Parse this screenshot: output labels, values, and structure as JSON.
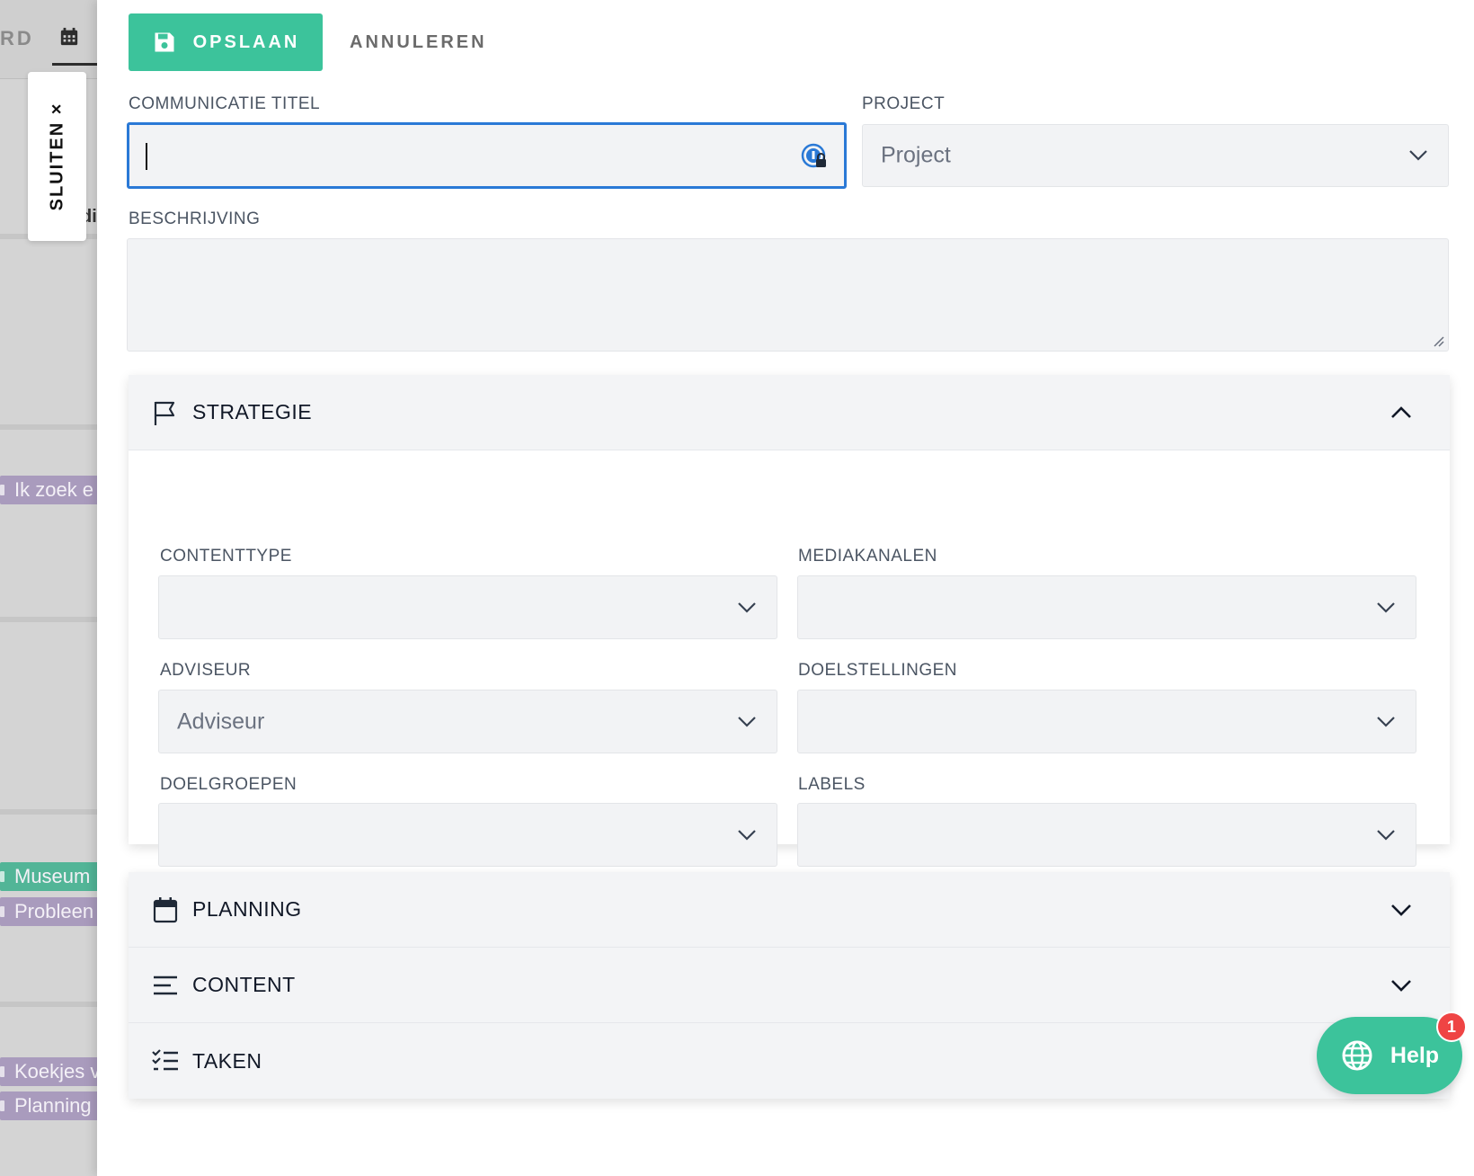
{
  "background": {
    "tab_partial_text": "RD",
    "body_fragment": "di",
    "chips": [
      {
        "label": "Ik zoek e",
        "color": "#a99bbd"
      },
      {
        "label": "Museum",
        "color": "#52b597"
      },
      {
        "label": "Probleen",
        "color": "#a99bbd"
      },
      {
        "label": "Koekjes v",
        "color": "#a99bbd"
      },
      {
        "label": "Planning",
        "color": "#a99bbd"
      }
    ]
  },
  "close_tab": {
    "label": "SLUITEN ×"
  },
  "toolbar": {
    "save_label": "OPSLAAN",
    "cancel_label": "ANNULEREN"
  },
  "form": {
    "title_label": "COMMUNICATIE TITEL",
    "title_value": "",
    "project_label": "PROJECT",
    "project_placeholder": "Project",
    "description_label": "BESCHRIJVING",
    "description_value": ""
  },
  "strategy": {
    "title": "STRATEGIE",
    "expanded": true,
    "fields": {
      "contenttype": {
        "label": "CONTENTTYPE",
        "value": ""
      },
      "mediakanalen": {
        "label": "MEDIAKANALEN",
        "value": ""
      },
      "adviseur": {
        "label": "ADVISEUR",
        "value": "Adviseur"
      },
      "doelstellingen": {
        "label": "DOELSTELLINGEN",
        "value": ""
      },
      "doelgroepen": {
        "label": "DOELGROEPEN",
        "value": ""
      },
      "labels": {
        "label": "LABELS",
        "value": ""
      }
    }
  },
  "sections": {
    "planning": {
      "title": "PLANNING",
      "expanded": false
    },
    "content": {
      "title": "CONTENT",
      "expanded": false
    },
    "taken": {
      "title": "TAKEN",
      "expanded": false
    }
  },
  "help": {
    "label": "Help",
    "badge": "1"
  },
  "colors": {
    "accent": "#3cc39b",
    "focus": "#2a79d6",
    "badge": "#ef4444",
    "chip_purple": "#a99bbd",
    "chip_green": "#52b597"
  }
}
